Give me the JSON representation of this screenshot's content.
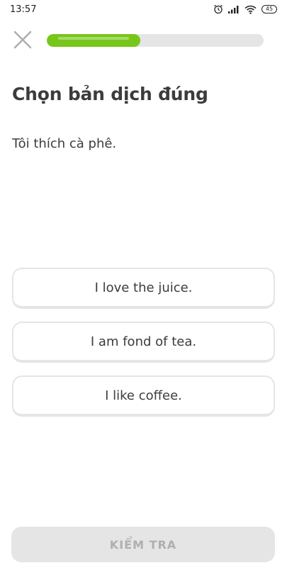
{
  "status_bar": {
    "time": "13:57",
    "battery": "45",
    "icons": [
      "alarm-icon",
      "signal-icon",
      "wifi-icon",
      "battery-icon"
    ]
  },
  "top_bar": {
    "close_icon": "close-icon",
    "progress_fraction": 0.43,
    "progress_color": "#77c61a",
    "track_color": "#e5e5e5"
  },
  "lesson": {
    "title": "Chọn bản dịch đúng",
    "prompt": "Tôi thích cà phê.",
    "choices": [
      {
        "label": "I love the juice."
      },
      {
        "label": "I am fond of tea."
      },
      {
        "label": "I like coffee."
      }
    ]
  },
  "footer": {
    "check_label": "KIỂM TRA",
    "check_enabled": false
  }
}
